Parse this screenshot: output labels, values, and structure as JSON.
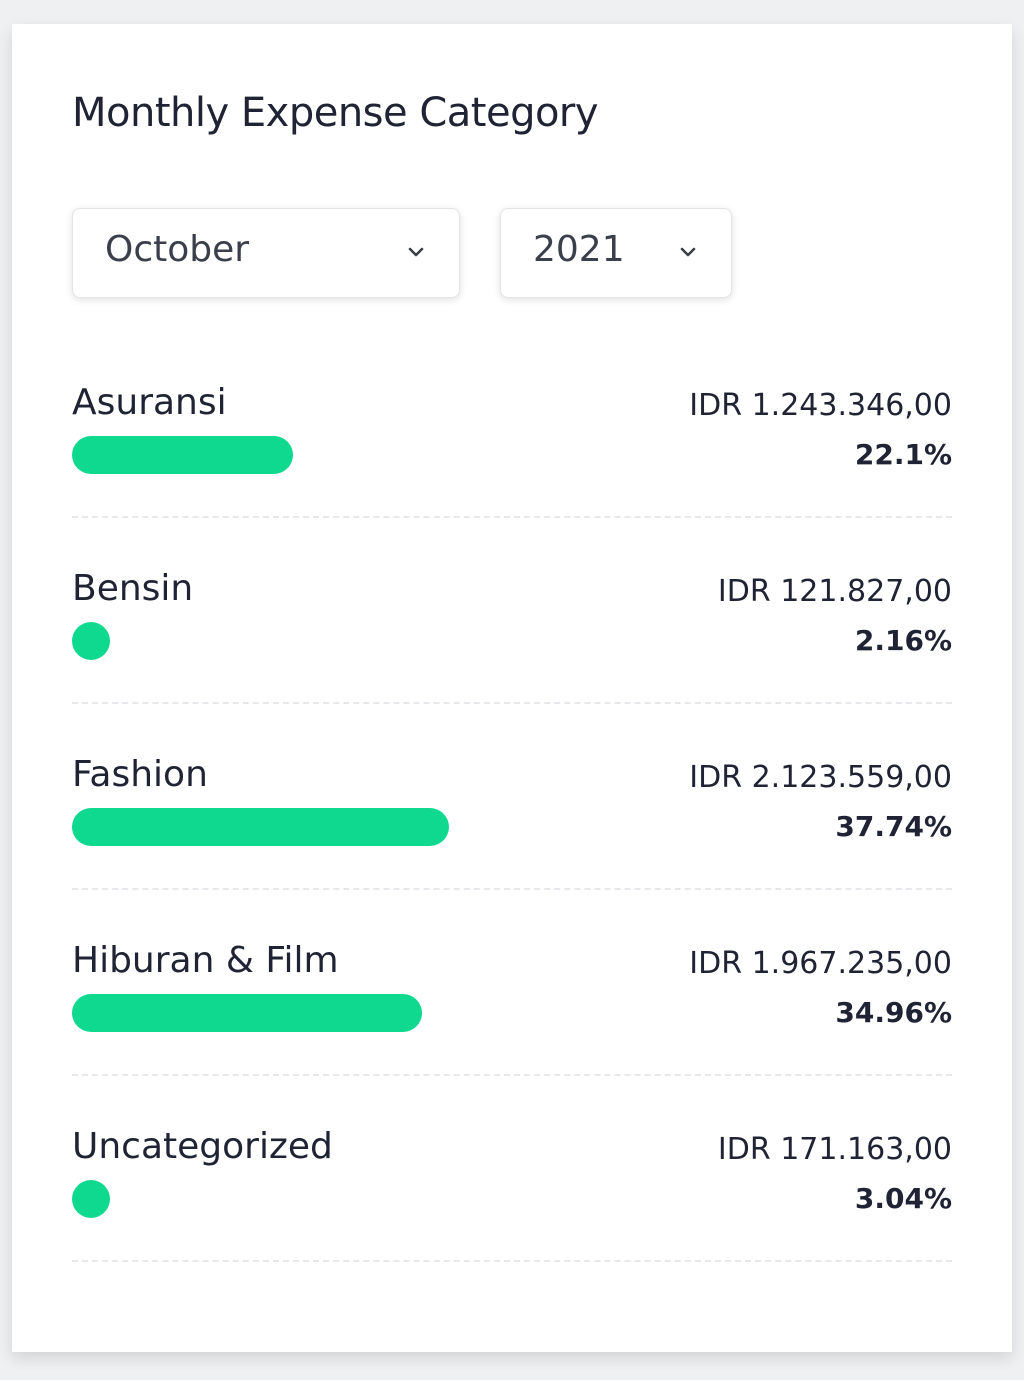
{
  "card": {
    "title": "Monthly Expense Category"
  },
  "filters": {
    "month": "October",
    "year": "2021"
  },
  "colors": {
    "bar": "#0fd98f"
  },
  "bar_scale_max_percent": 88,
  "categories": [
    {
      "name": "Asuransi",
      "amount": "IDR 1.243.346,00",
      "percent_label": "22.1%",
      "percent": 22.1
    },
    {
      "name": "Bensin",
      "amount": "IDR 121.827,00",
      "percent_label": "2.16%",
      "percent": 2.16
    },
    {
      "name": "Fashion",
      "amount": "IDR 2.123.559,00",
      "percent_label": "37.74%",
      "percent": 37.74
    },
    {
      "name": "Hiburan & Film",
      "amount": "IDR 1.967.235,00",
      "percent_label": "34.96%",
      "percent": 34.96
    },
    {
      "name": "Uncategorized",
      "amount": "IDR 171.163,00",
      "percent_label": "3.04%",
      "percent": 3.04
    }
  ]
}
